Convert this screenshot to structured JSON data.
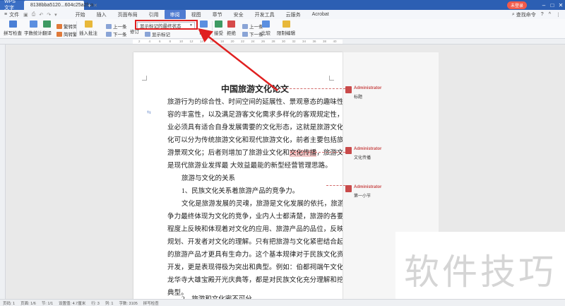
{
  "titlebar": {
    "app_tab": "WPS 文字",
    "doc_tab": "8138bba5120...604c25a2faa",
    "new_tab": "+",
    "login": "未登录",
    "win_min": "–",
    "win_max": "□",
    "win_close": "✕"
  },
  "menubar": {
    "file": "文件",
    "items": [
      "开始",
      "插入",
      "页面布局",
      "引用",
      "审阅",
      "视图",
      "章节",
      "安全",
      "开发工具",
      "云服务",
      "Acrobat"
    ],
    "active_index": 4,
    "search": "查找命令",
    "right_icons": [
      "?",
      "^",
      "⋮"
    ]
  },
  "ribbon": {
    "spell_check": "拼写检查",
    "word_count": "字数统计",
    "translate": "翻译",
    "simp_trad": "繁转简",
    "trad_simp": "简转繁",
    "insert_comment": "插入批注",
    "prev_comment": "上一条",
    "next_comment": "下一条",
    "track_changes": "修订",
    "show_markup": "显示标记",
    "markup_view": "显示标记的最终状态",
    "review_pane": "审阅",
    "accept": "接受",
    "reject": "拒绝",
    "prev_change": "上一条",
    "next_change": "下一条",
    "compare": "比较",
    "restrict_edit": "限制编辑"
  },
  "document": {
    "title": "中国旅游文化论文",
    "paragraph1_lines": [
      "旅游行为的综合性、时间空间的延展性、景观意态的趣味性、旅游内",
      "容的丰富性，以及满足游客文化需求多样化的客观规定性，促使旅游",
      "业必须具有适合自身发展需要的文化形态，这就是旅游文化。旅游文",
      "化可以分为传统旅游文化和现代旅游文化，前者主要包括旅游者和旅",
      "游景观文化；后者则增加了旅游业文化和",
      "是现代旅游业发挥最  大效益最能的新型经营管理思路。"
    ],
    "highlight": "文化传播",
    "line5_rest": "，旅游文化建设乃",
    "subhead1": "旅游与文化的关系",
    "item1": "1、民族文化关系着旅游产品的竞争力。",
    "paragraph2_lines": [
      "文化是旅游发展的灵魂，旅游是文化发展的依托，旅游产品的竞",
      "争力最终体现为文化的竞争，业内人士都清楚，旅游的各要素在一定",
      "程度上反映和体现着对文化的应用、旅游产品的品位，反映了策划、",
      "规划、开发者对文化的理解。只有把旅游与文化紧密结合起来，这样",
      "的旅游产品才更具有生命力。这个基本规律对于民族文化资源的旅游",
      "开发，更是表现得极为突出和典型。例如：伯都祠端午文化旅游节、",
      "龙华寺大雄宝殿开光庆典等，都是对民族文化充分理解和挖掘运用的",
      "典型。"
    ],
    "item2": "2、旅游和文化密不可分。"
  },
  "comments": [
    {
      "author": "Administrator",
      "text": "标题"
    },
    {
      "author": "Administrator",
      "text": "文化传播"
    },
    {
      "author": "Administrator",
      "text": "第一小节"
    }
  ],
  "statusbar": {
    "page_num": "页码: 1",
    "pages": "页面: 1/6",
    "section": "节: 1/1",
    "position": "设置值: 4.7厘米",
    "row": "行: 3",
    "col": "列: 1",
    "word_count": "字数: 3105",
    "spell": "拼写检查"
  },
  "ruler_ticks": [
    "2",
    "4",
    "6",
    "8",
    "10",
    "12",
    "14",
    "16",
    "18",
    "20",
    "22",
    "24",
    "26",
    "28",
    "30",
    "32",
    "34",
    "36",
    "38",
    "40"
  ],
  "watermark": "软件技巧",
  "colors": {
    "title_bar": "#2c5fb3",
    "active_menu": "#4f7bd1",
    "comment_red": "#c94a4a",
    "arrow_red": "#e02020"
  }
}
